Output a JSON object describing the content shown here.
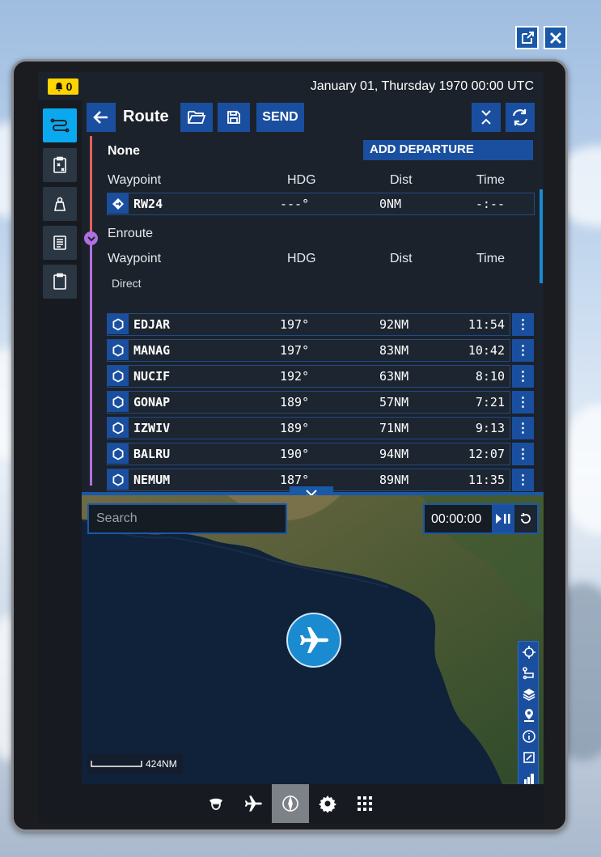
{
  "window_controls": {
    "popout_icon": "popout-icon",
    "close_icon": "close-icon"
  },
  "status": {
    "notification_count": "0",
    "datetime": "January 01, Thursday 1970 00:00 UTC"
  },
  "sidebar": {
    "items": [
      {
        "name": "sidebar-item-route",
        "icon": "route-icon",
        "active": true
      },
      {
        "name": "sidebar-item-checklist",
        "icon": "clipboard-x-icon",
        "active": false
      },
      {
        "name": "sidebar-item-weight",
        "icon": "weight-icon",
        "active": false
      },
      {
        "name": "sidebar-item-notes",
        "icon": "document-icon",
        "active": false
      },
      {
        "name": "sidebar-item-clipboard",
        "icon": "clipboard-icon",
        "active": false
      }
    ]
  },
  "toolbar": {
    "back_icon": "arrow-left-icon",
    "title": "Route",
    "open_icon": "folder-open-icon",
    "save_icon": "save-icon",
    "send_label": "SEND",
    "collapse_icon": "collapse-vertical-icon",
    "refresh_icon": "refresh-icon"
  },
  "departure": {
    "label": "None",
    "add_button": "ADD DEPARTURE",
    "headers": {
      "waypoint": "Waypoint",
      "hdg": "HDG",
      "dist": "Dist",
      "time": "Time"
    },
    "rows": [
      {
        "name": "RW24",
        "hdg": "---°",
        "dist": "0NM",
        "time": "-:--"
      }
    ]
  },
  "enroute": {
    "label": "Enroute",
    "headers": {
      "waypoint": "Waypoint",
      "hdg": "HDG",
      "dist": "Dist",
      "time": "Time"
    },
    "airway": "Direct",
    "rows": [
      {
        "name": "EDJAR",
        "hdg": "197°",
        "dist": "92NM",
        "time": "11:54"
      },
      {
        "name": "MANAG",
        "hdg": "197°",
        "dist": "83NM",
        "time": "10:42"
      },
      {
        "name": "NUCIF",
        "hdg": "192°",
        "dist": "63NM",
        "time": "8:10"
      },
      {
        "name": "GONAP",
        "hdg": "189°",
        "dist": "57NM",
        "time": "7:21"
      },
      {
        "name": "IZWIV",
        "hdg": "189°",
        "dist": "71NM",
        "time": "9:13"
      },
      {
        "name": "BALRU",
        "hdg": "190°",
        "dist": "94NM",
        "time": "12:07"
      },
      {
        "name": "NEMUM",
        "hdg": "187°",
        "dist": "89NM",
        "time": "11:35"
      }
    ],
    "more_glyph": "⋮"
  },
  "map": {
    "search_placeholder": "Search",
    "timer": "00:00:00",
    "scale_label": "424NM",
    "tools": [
      "crosshair-icon",
      "route-path-icon",
      "layers-icon",
      "location-pin-icon",
      "info-icon",
      "expand-icon",
      "bar-chart-icon"
    ]
  },
  "colors": {
    "accent": "#1a4fa0",
    "active_sidebar": "#0aa8ee",
    "timeline_departure": "#e0625a",
    "timeline_enroute": "#b070e0",
    "notification": "#ffd400"
  },
  "bottom_nav": [
    "pilot-icon",
    "airplane-icon",
    "compass-icon",
    "gear-icon",
    "apps-grid-icon"
  ]
}
